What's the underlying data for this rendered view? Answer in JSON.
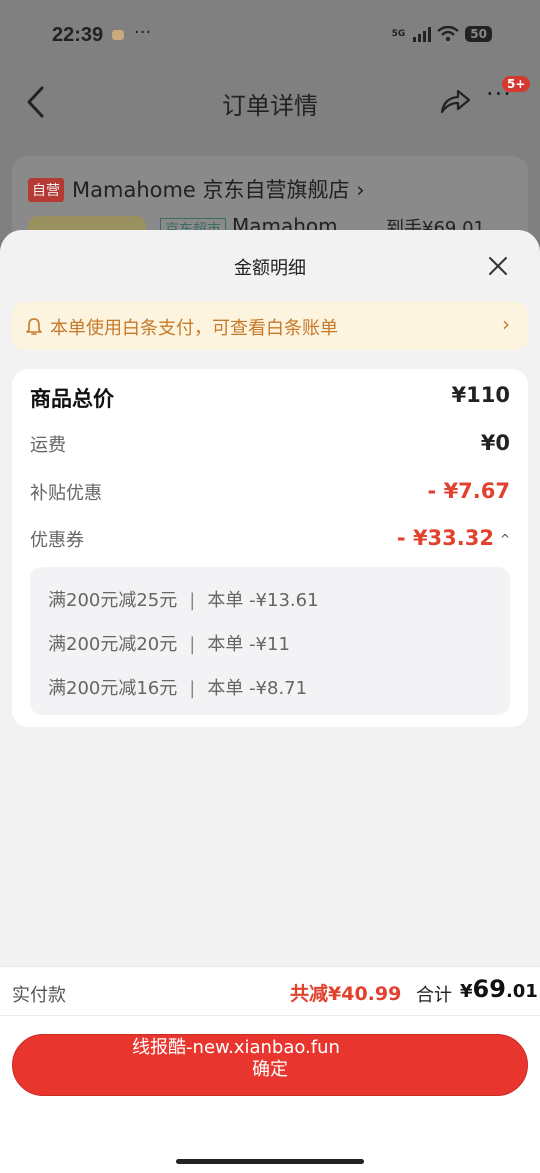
{
  "status_bar": {
    "time": "22:39",
    "dots": "···",
    "network": "5G",
    "battery": "50"
  },
  "nav": {
    "title": "订单详情",
    "badge": "5+",
    "more": "···"
  },
  "store": {
    "tag": "自营",
    "name": "Mamahome 京东自营旗舰店 ›",
    "chip": "京东超市",
    "product_name": "Mamahom",
    "price": "到手¥69.01"
  },
  "sheet": {
    "title": "金额明细"
  },
  "notice": {
    "text": "本单使用白条支付，可查看白条账单",
    "arrow": "›"
  },
  "details": {
    "goods_total": {
      "label": "商品总价",
      "value": "¥110"
    },
    "shipping": {
      "label": "运费",
      "value": "¥0"
    },
    "subsidy": {
      "label": "补贴优惠",
      "value": "- ¥7.67"
    },
    "coupon": {
      "label": "优惠券",
      "value": "- ¥33.32",
      "caret": "^"
    }
  },
  "coupons": [
    {
      "rule": "满200元减25元",
      "sep": "|",
      "amount": "本单 -¥13.61"
    },
    {
      "rule": "满200元减20元",
      "sep": "|",
      "amount": "本单 -¥11"
    },
    {
      "rule": "满200元减16元",
      "sep": "|",
      "amount": "本单 -¥8.71"
    }
  ],
  "bottom": {
    "paid_label": "实付款",
    "saved": "共减¥40.99",
    "total_label": "合计",
    "total_yen": "¥",
    "total_int": "69",
    "total_dec": ".01",
    "watermark": "线报酷-new.xianbao.fun",
    "confirm": "确定"
  },
  "colors": {
    "accent": "#e8362f",
    "notice_bg": "#fdf4df",
    "notice_text": "#c67a2a",
    "discount": "#e2412e"
  }
}
